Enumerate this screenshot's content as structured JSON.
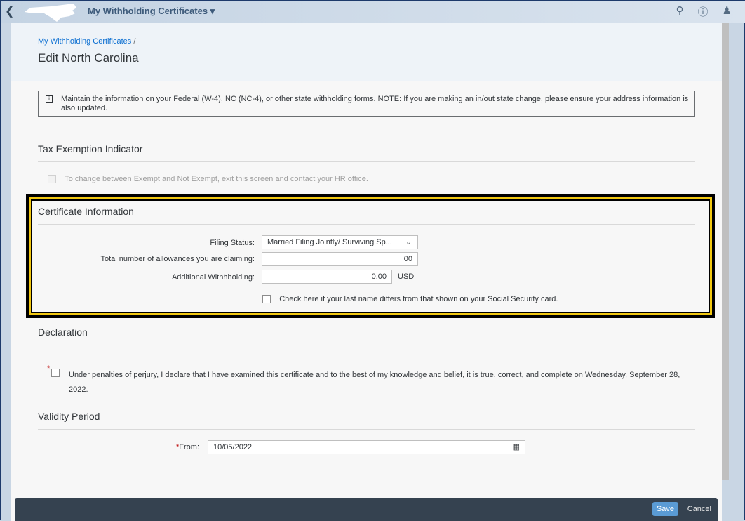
{
  "shell": {
    "title": "My Withholding Certificates",
    "icons": [
      "back-icon",
      "search-icon",
      "help-icon",
      "user-icon"
    ]
  },
  "breadcrumb": {
    "link": "My Withholding Certificates",
    "sep": "/"
  },
  "page_title": "Edit North Carolina",
  "message": "Maintain the information on your Federal (W-4), NC (NC-4), or other state withholding forms. NOTE: If you are making an in/out state change, please ensure your address information is also updated.",
  "tax_exemption": {
    "title": "Tax Exemption Indicator",
    "checkbox_label": "To change between Exempt and Not Exempt, exit this screen and contact your HR office."
  },
  "certificate": {
    "title": "Certificate Information",
    "filing_status_label": "Filing Status:",
    "filing_status_value": "Married Filing Jointly/ Surviving Sp...",
    "allowances_label": "Total number of allowances you are claiming:",
    "allowances_value": "00",
    "additional_label": "Additional Withhholding:",
    "additional_value": "0.00",
    "currency": "USD",
    "last_name_label": "Check here if your last name differs from that shown on your Social Security card."
  },
  "declaration": {
    "title": "Declaration",
    "required": "*",
    "text": "Under penalties of perjury, I declare that I have examined this certificate and to the best of my knowledge and belief, it is true, correct, and complete on Wednesday, September 28, 2022."
  },
  "validity": {
    "title": "Validity Period",
    "required": "*",
    "from_label": "From:",
    "from_value": "10/05/2022"
  },
  "footer": {
    "save": "Save",
    "cancel": "Cancel"
  },
  "colors": {
    "accent": "#0a6ed1",
    "highlight": "#f2c811",
    "footer": "#354250"
  }
}
